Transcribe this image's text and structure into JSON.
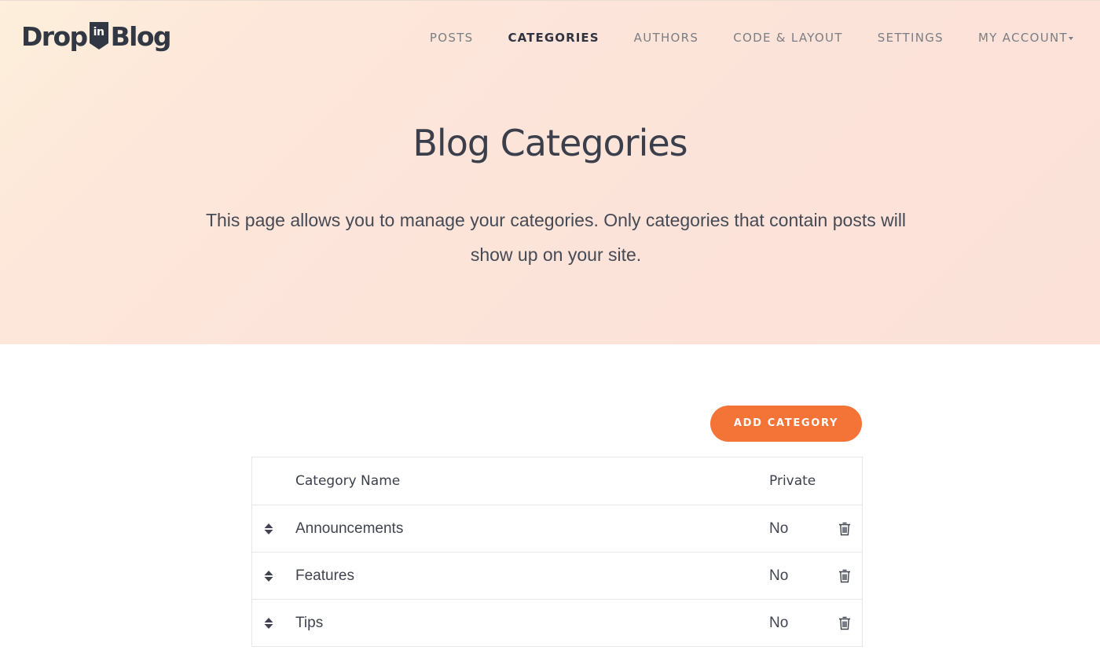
{
  "brand": {
    "logo_left": "Drop",
    "logo_badge": "in",
    "logo_right": "Blog"
  },
  "nav": {
    "items": [
      {
        "label": "POSTS",
        "active": false
      },
      {
        "label": "CATEGORIES",
        "active": true
      },
      {
        "label": "AUTHORS",
        "active": false
      },
      {
        "label": "CODE & LAYOUT",
        "active": false
      },
      {
        "label": "SETTINGS",
        "active": false
      },
      {
        "label": "MY ACCOUNT",
        "active": false,
        "dropdown": true
      }
    ]
  },
  "hero": {
    "title": "Blog Categories",
    "description": "This page allows you to manage your categories. Only categories that contain posts will show up on your site."
  },
  "actions": {
    "add_label": "ADD CATEGORY"
  },
  "table": {
    "columns": [
      "Category Name",
      "Private"
    ],
    "rows": [
      {
        "name": "Announcements",
        "private": "No"
      },
      {
        "name": "Features",
        "private": "No"
      },
      {
        "name": "Tips",
        "private": "No"
      }
    ]
  },
  "icons": {
    "drag": "sort-icon",
    "delete": "trash-icon",
    "dropdown": "caret-down-icon"
  },
  "colors": {
    "accent": "#f47438",
    "text_dark": "#3a3f4b",
    "nav_muted": "#7b7e84",
    "hero_start": "#fdefdb",
    "hero_end": "#fbe1d8",
    "border": "#e6e6e6"
  }
}
